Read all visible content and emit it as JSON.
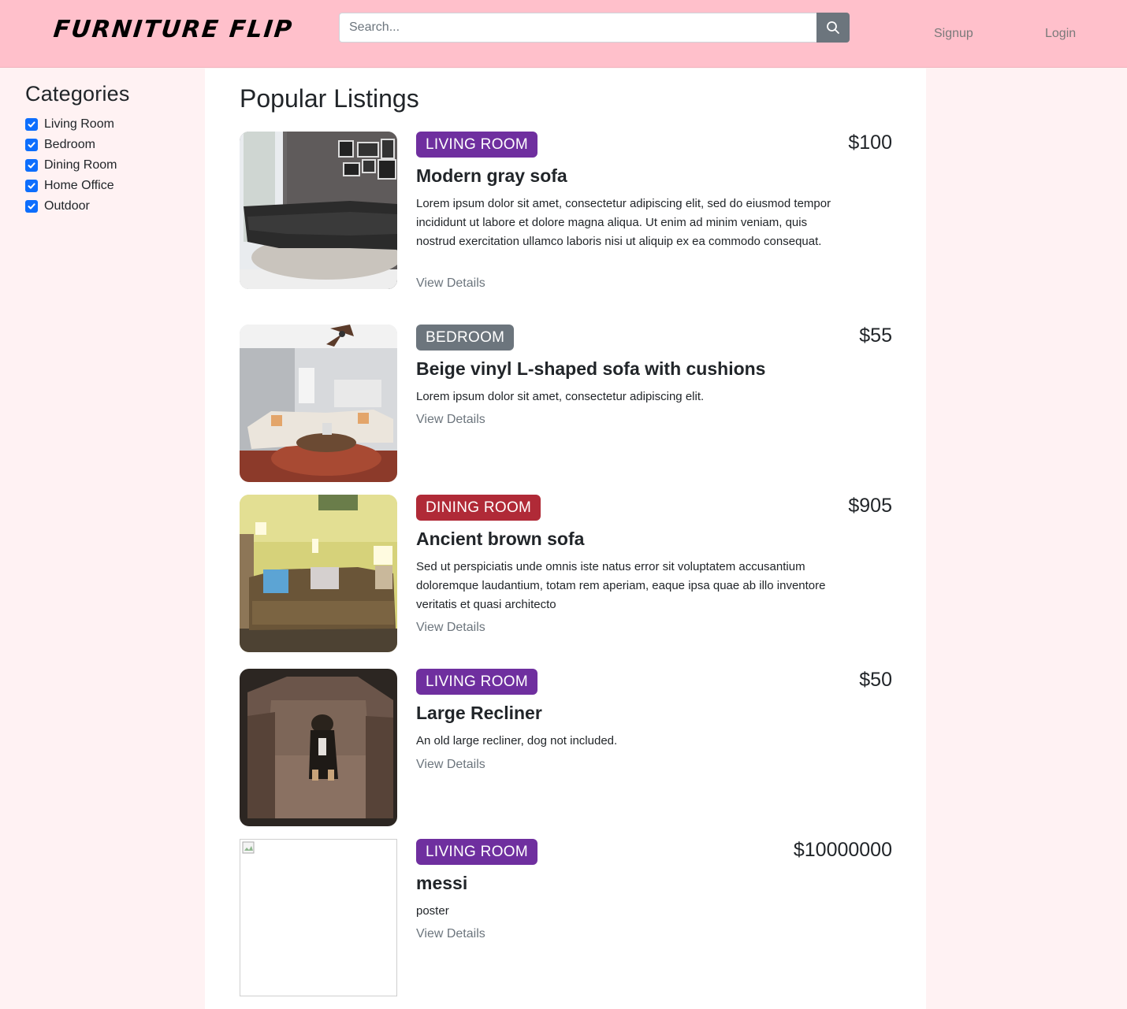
{
  "brand": {
    "logo": "FURNITURE FLIP"
  },
  "search": {
    "placeholder": "Search..."
  },
  "nav": {
    "signup": "Signup",
    "login": "Login"
  },
  "sidebar": {
    "title": "Categories",
    "items": [
      {
        "label": "Living Room",
        "checked": true
      },
      {
        "label": "Bedroom",
        "checked": true
      },
      {
        "label": "Dining Room",
        "checked": true
      },
      {
        "label": "Home Office",
        "checked": true
      },
      {
        "label": "Outdoor",
        "checked": true
      }
    ]
  },
  "main": {
    "title": "Popular Listings",
    "view_details_label": "View Details",
    "listings": [
      {
        "category": "LIVING ROOM",
        "category_color": "#6f2f9f",
        "title": "Modern gray sofa",
        "price": "$100",
        "description": "Lorem ipsum dolor sit amet, consectetur adipiscing elit, sed do eiusmod tempor incididunt ut labore et dolore magna aliqua. Ut enim ad minim veniam, quis nostrud exercitation ullamco laboris nisi ut aliquip ex ea commodo consequat.",
        "link": "View Details"
      },
      {
        "category": "BEDROOM",
        "category_color": "#6c757d",
        "title": "Beige vinyl L-shaped sofa with cushions",
        "price": "$55",
        "description": "Lorem ipsum dolor sit amet, consectetur adipiscing elit.",
        "link": "View Details"
      },
      {
        "category": "DINING ROOM",
        "category_color": "#b02a37",
        "title": "Ancient brown sofa",
        "price": "$905",
        "description": "Sed ut perspiciatis unde omnis iste natus error sit voluptatem accusantium doloremque laudantium, totam rem aperiam, eaque ipsa quae ab illo inventore veritatis et quasi architecto",
        "link": "View Details"
      },
      {
        "category": "LIVING ROOM",
        "category_color": "#6f2f9f",
        "title": "Large Recliner",
        "price": "$50",
        "description": "An old large recliner, dog not included.",
        "link": "View Details"
      },
      {
        "category": "LIVING ROOM",
        "category_color": "#6f2f9f",
        "title": "messi",
        "price": "$10000000",
        "description": "poster",
        "link": "View Details"
      }
    ]
  },
  "colors": {
    "header_bg": "#ffc0cb",
    "page_bg": "#fff2f3",
    "checkbox": "#0d6efd",
    "search_button": "#6c757d"
  }
}
